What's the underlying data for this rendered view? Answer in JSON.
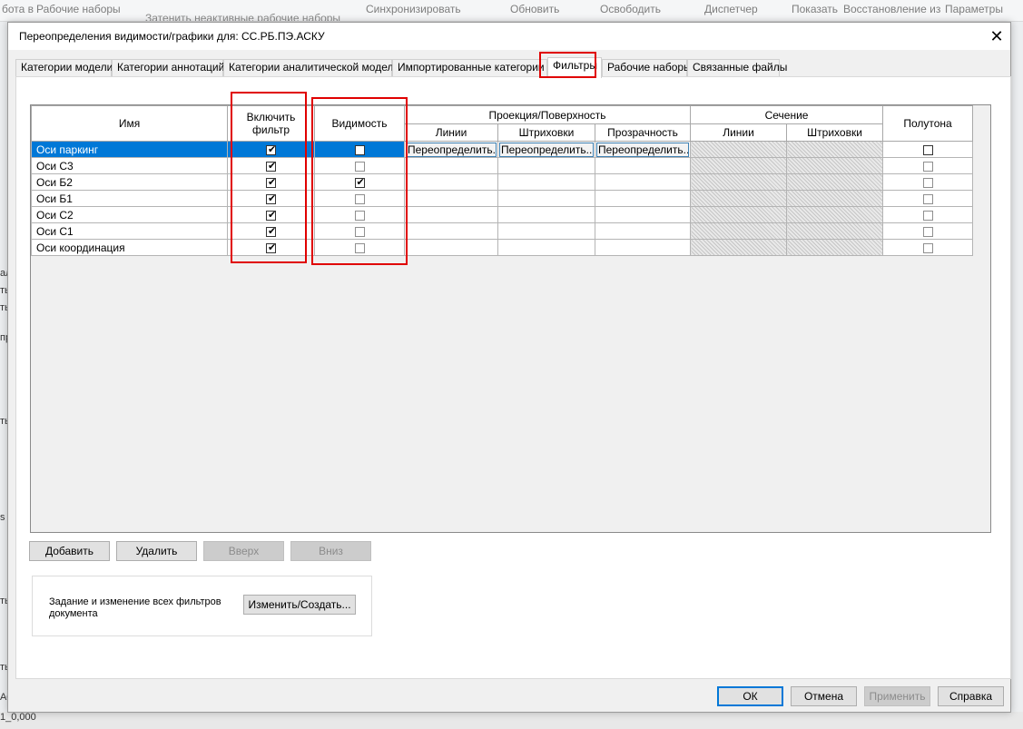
{
  "background": {
    "ribbon": {
      "item1": "бота в",
      "item2": "Рабочие наборы",
      "item3": "Затенить неактивные рабочие наборы",
      "item4": "Синхронизировать",
      "item5": "Обновить",
      "item6": "Освободить",
      "item7": "Диспетчер",
      "item8": "Показать",
      "item9": "Восстановление из",
      "item10": "Параметры"
    },
    "left_edge": {
      "t1": "ал",
      "t2": "ть",
      "t3": "ть",
      "t4": "пр",
      "t5": "ть",
      "t6": "s",
      "t7": "ть",
      "t8": "ть",
      "t9": "АС"
    },
    "bottom_text": "1_0,000"
  },
  "dialog": {
    "title": "Переопределения видимости/графики для: СС.РБ.ПЭ.АСКУ",
    "close_glyph": "✕",
    "tabs": [
      {
        "label": "Категории модели"
      },
      {
        "label": "Категории аннотаций"
      },
      {
        "label": "Категории аналитической модели"
      },
      {
        "label": "Импортированные категории"
      },
      {
        "label": "Фильтры"
      },
      {
        "label": "Рабочие наборы"
      },
      {
        "label": "Связанные файлы"
      }
    ],
    "active_tab": "Фильтры",
    "grid": {
      "headers": {
        "name": "Имя",
        "enable_filter": "Включить фильтр",
        "visibility": "Видимость",
        "projection_group": "Проекция/Поверхность",
        "proj_lines": "Линии",
        "proj_patterns": "Штриховки",
        "proj_transparency": "Прозрачность",
        "section_group": "Сечение",
        "sec_lines": "Линии",
        "sec_patterns": "Штриховки",
        "halftone": "Полутона"
      },
      "override_label": "Переопределить...",
      "rows": [
        {
          "name": "Оси паркинг",
          "enabled": true,
          "visible": false,
          "halftone": false,
          "selected": true
        },
        {
          "name": "Оси С3",
          "enabled": true,
          "visible": false,
          "halftone": false,
          "selected": false
        },
        {
          "name": "Оси Б2",
          "enabled": true,
          "visible": true,
          "halftone": false,
          "selected": false
        },
        {
          "name": "Оси Б1",
          "enabled": true,
          "visible": false,
          "halftone": false,
          "selected": false
        },
        {
          "name": "Оси С2",
          "enabled": true,
          "visible": false,
          "halftone": false,
          "selected": false
        },
        {
          "name": "Оси С1",
          "enabled": true,
          "visible": false,
          "halftone": false,
          "selected": false
        },
        {
          "name": "Оси координация",
          "enabled": true,
          "visible": false,
          "halftone": false,
          "selected": false
        }
      ]
    },
    "buttons": {
      "add": "Добавить",
      "remove": "Удалить",
      "up": "Вверх",
      "down": "Вниз"
    },
    "filters_group": {
      "label": "Задание и изменение всех фильтров документа",
      "edit_button": "Изменить/Создать..."
    },
    "footer": {
      "ok": "ОК",
      "cancel": "Отмена",
      "apply": "Применить",
      "help": "Справка"
    },
    "colors": {
      "selection": "#0078d7",
      "highlight": "#e00000"
    }
  }
}
